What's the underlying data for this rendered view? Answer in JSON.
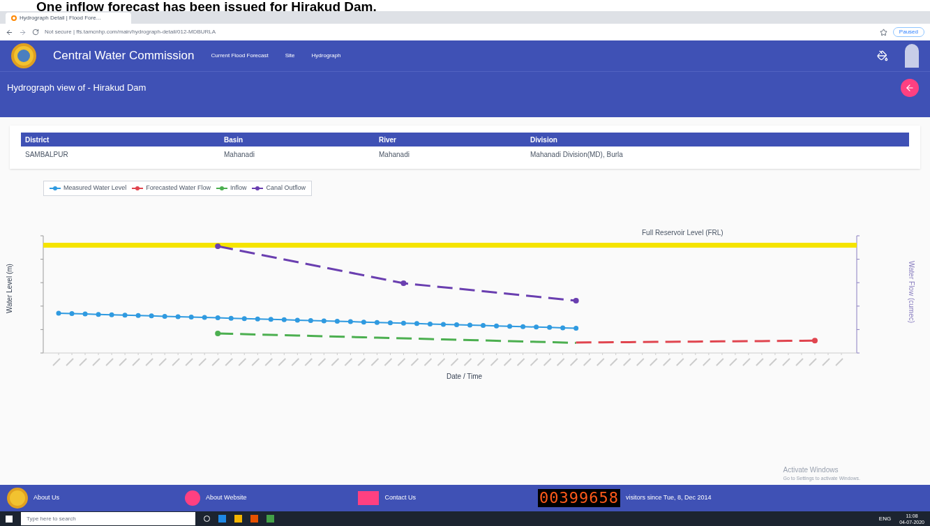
{
  "banner": "One inflow forecast has been issued for Hirakud Dam.",
  "browser": {
    "tab_title": "Hydrograph Detail | Flood Fore...",
    "address": "Not secure | ffs.tamcnhp.com/main/hydrograph-detail/012-MDBURLA",
    "profile": "Paused"
  },
  "header": {
    "title": "Central Water Commission",
    "nav": [
      {
        "label": "Current Flood Forecast"
      },
      {
        "label": "Site"
      },
      {
        "label": "Hydrograph"
      }
    ]
  },
  "page_title": "Hydrograph view of - Hirakud Dam",
  "table": {
    "columns": [
      "District",
      "Basin",
      "River",
      "Division"
    ],
    "rows": [
      [
        "SAMBALPUR",
        "Mahanadi",
        "Mahanadi",
        "Mahanadi Division(MD), Burla"
      ]
    ]
  },
  "legend": [
    {
      "label": "Measured Water Level",
      "color": "#2f9ae0"
    },
    {
      "label": "Forecasted Water Flow",
      "color": "#e0454f"
    },
    {
      "label": "Inflow",
      "color": "#4caf50"
    },
    {
      "label": "Canal Outflow",
      "color": "#6a3fb0"
    }
  ],
  "chart": {
    "frl_label": "Full Reservoir Level (FRL)",
    "ylabel": "Water Level (m)",
    "y2label": "Water Flow (cumec)",
    "xlabel": "Date / Time"
  },
  "footer": {
    "links": [
      {
        "label": "About Us"
      },
      {
        "label": "About Website"
      },
      {
        "label": "Contact Us"
      }
    ],
    "counter": "00399658",
    "since": "visitors since Tue, 8, Dec 2014"
  },
  "activate": {
    "title": "Activate Windows",
    "hint": "Go to Settings to activate Windows."
  },
  "taskbar": {
    "search": "Type here to search",
    "lang": "ENG",
    "time": "11:08",
    "date": "04-07-2020"
  }
}
